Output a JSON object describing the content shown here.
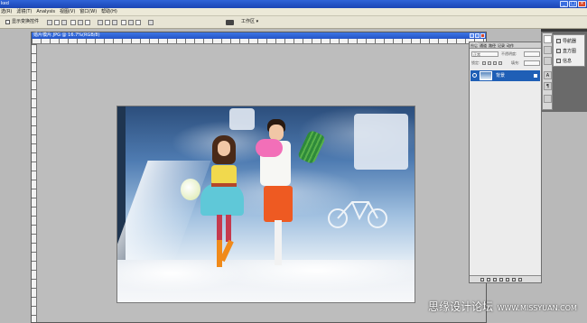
{
  "window": {
    "title": "ked",
    "controls": [
      "_",
      "□",
      "×"
    ]
  },
  "menu": [
    "选(R)",
    "滤镜(T)",
    "Analysis",
    "视图(V)",
    "窗口(W)",
    "帮助(H)"
  ],
  "options_bar": {
    "checkbox_label": "显示变换控件",
    "workspace_label": "工作区 ▾"
  },
  "document": {
    "title": "婚片模片.JPG @ 16.7%(RGB/8)"
  },
  "nav_panel": {
    "items": [
      "导航器",
      "直方图",
      "信息"
    ]
  },
  "layers_panel": {
    "tabs": [
      "图层",
      "通道",
      "路径",
      "记录",
      "动作"
    ],
    "blend_mode": "正常",
    "opacity_label": "不透明度:",
    "lock_label": "锁定:",
    "fill_label": "填充:",
    "layer_name": "背景"
  },
  "watermark": {
    "text": "思缘设计论坛",
    "url": "WWW.MISSYUAN.COM"
  }
}
